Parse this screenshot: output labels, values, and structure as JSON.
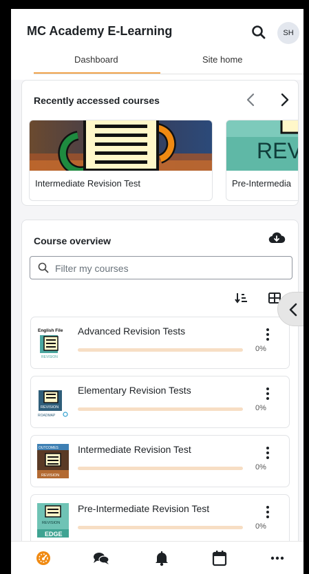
{
  "app": {
    "title": "MC Academy E-Learning",
    "user_initials": "SH"
  },
  "tabs": [
    {
      "label": "Dashboard",
      "active": true
    },
    {
      "label": "Site home",
      "active": false
    }
  ],
  "recent": {
    "heading": "Recently accessed courses",
    "courses": [
      {
        "title": "Intermediate Revision Test",
        "image": "revision-file-icon-thumbnail"
      },
      {
        "title": "Pre-Intermedia",
        "image": "revision-banner-thumbnail"
      }
    ],
    "thumbnail_text": "REV"
  },
  "overview": {
    "heading": "Course overview",
    "filter_placeholder": "Filter my courses",
    "courses": [
      {
        "title": "Advanced Revision Tests",
        "progress_percent": 0,
        "progress_label": "0%",
        "thumb_text_top": "English File",
        "thumb_text_bottom": "REVISION"
      },
      {
        "title": "Elementary Revision Tests",
        "progress_percent": 0,
        "progress_label": "0%",
        "thumb_text_top": "REVISION",
        "thumb_text_bottom": "ROADMAP"
      },
      {
        "title": "Intermediate Revision Test",
        "progress_percent": 0,
        "progress_label": "0%",
        "thumb_text_top": "OUTCOMES",
        "thumb_text_bottom": "REVISION"
      },
      {
        "title": "Pre-Intermediate Revision Test",
        "progress_percent": 0,
        "progress_label": "0%",
        "thumb_text_top": "REVISION",
        "thumb_text_bottom": "EDGE"
      }
    ]
  },
  "colors": {
    "accent": "#f0a34b",
    "progress_track": "#f7dec4",
    "tile_icon_green": "#1e8a3f",
    "tile_icon_orange": "#f08a12"
  }
}
